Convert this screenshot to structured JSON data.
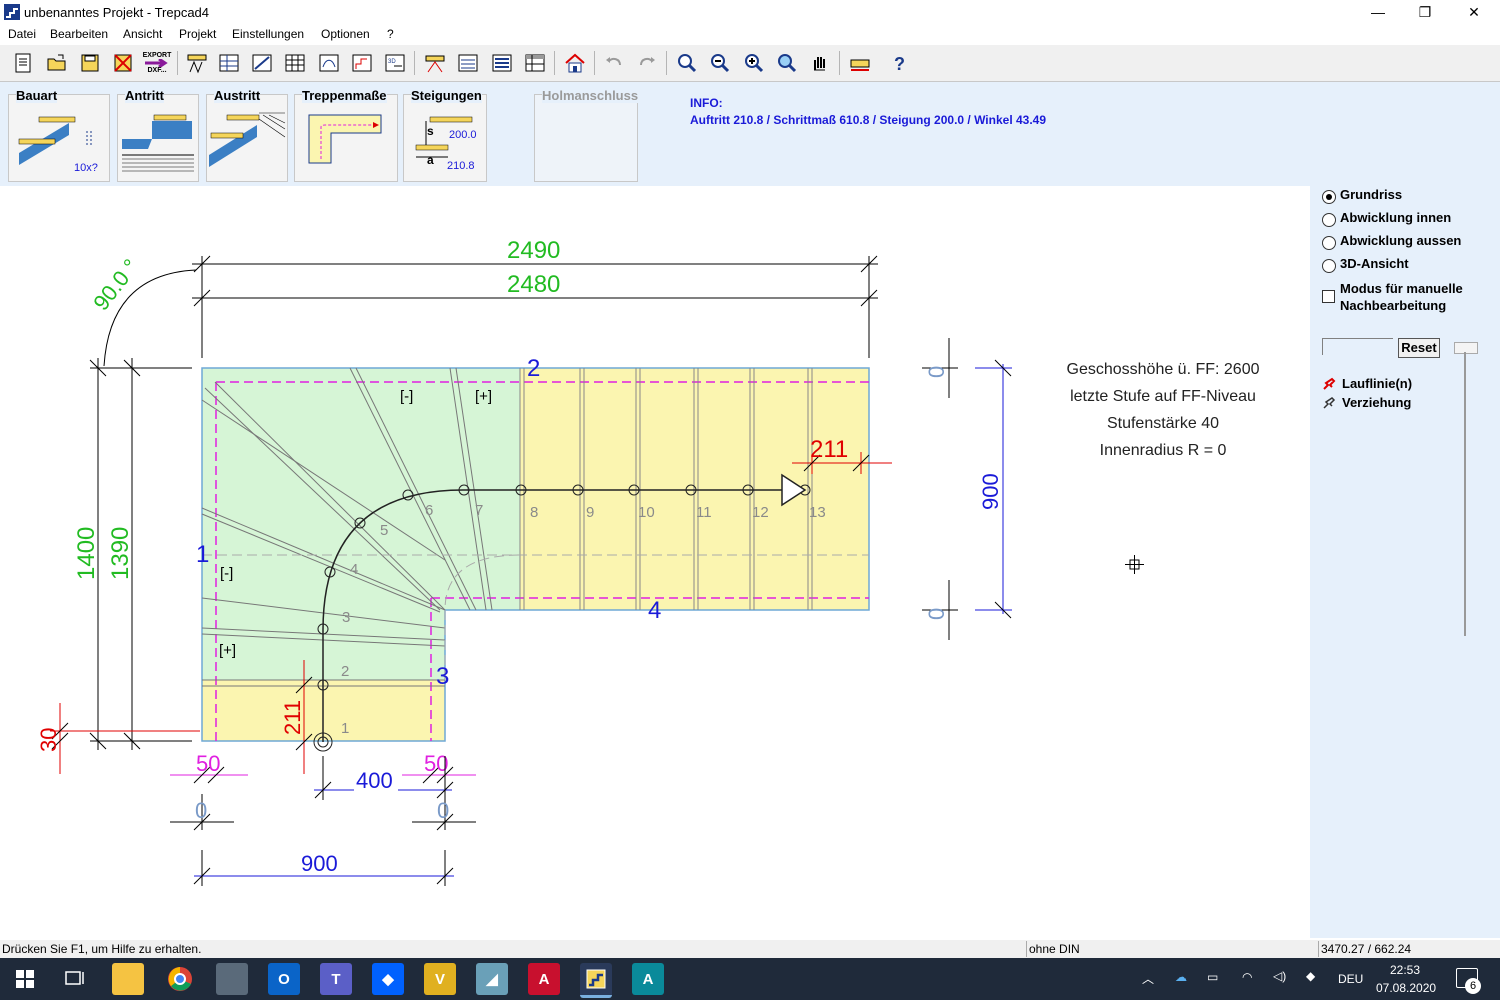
{
  "window": {
    "title": "unbenanntes Projekt - Trepcad4",
    "minimize_glyph": "—",
    "restore_glyph": "❐",
    "close_glyph": "✕"
  },
  "menu": [
    "Datei",
    "Bearbeiten",
    "Ansicht",
    "Projekt",
    "Einstellungen",
    "Optionen",
    "?"
  ],
  "toolbar": {
    "export_label_1": "EXPORT",
    "export_label_2": "DXF...",
    "icons": [
      "new-file-icon",
      "open-folder-icon",
      "save-icon",
      "delete-icon",
      "export-dxf-icon",
      "stair-type-icon",
      "plan-table-icon",
      "stair-side-icon",
      "grid-table-icon",
      "stair-view-icon",
      "profile-icon",
      "3d-view-icon",
      "stair-3d-icon",
      "stair-mirror-icon",
      "list-icon",
      "table-icon",
      "house-icon",
      "undo-icon",
      "redo-icon",
      "zoom-window-icon",
      "zoom-out-icon",
      "zoom-in-icon",
      "zoom-all-icon",
      "pan-icon",
      "measure-icon",
      "help-icon"
    ]
  },
  "panel": {
    "bauart": {
      "label": "Bauart",
      "count": "10x?"
    },
    "antritt": {
      "label": "Antritt"
    },
    "austritt": {
      "label": "Austritt"
    },
    "treppenmasse": {
      "label": "Treppenmaße"
    },
    "steigungen": {
      "label": "Steigungen",
      "s_label": "s",
      "a_label": "a",
      "s_value": "200.0",
      "a_value": "210.8"
    },
    "holmanschluss": {
      "label": "Holmanschluss"
    }
  },
  "info": {
    "heading": "INFO:",
    "text": "Auftritt 210.8 / Schrittmaß 610.8 / Steigung 200.0 / Winkel 43.49"
  },
  "view_options": {
    "grundriss": "Grundriss",
    "innen": "Abwicklung innen",
    "aussen": "Abwicklung aussen",
    "ansicht3d": "3D-Ansicht",
    "manual_line1": "Modus für manuelle",
    "manual_line2": "Nachbearbeitung",
    "selected": "Grundriss",
    "reset": "Reset",
    "lauflinie": "Lauflinie(n)",
    "verziehung": "Verziehung"
  },
  "drawing": {
    "dims": {
      "top_outer": "2490",
      "top_inner": "2480",
      "angle": "90.0 °",
      "left_outer": "1400",
      "left_inner": "1390",
      "right_height": "900",
      "bottom_width": "900",
      "bottom_400": "400",
      "edge_50_left": "50",
      "edge_50_right": "50",
      "red_211_top": "211",
      "red_211_left": "211",
      "red_30": "30",
      "zero": "0"
    },
    "edges": {
      "e1": "1",
      "e2": "2",
      "e3": "3",
      "e4": "4"
    },
    "markers": {
      "minus": "[-]",
      "plus": "[+]"
    },
    "steps": [
      "1",
      "2",
      "3",
      "4",
      "5",
      "6",
      "7",
      "8",
      "9",
      "10",
      "11",
      "12",
      "13"
    ],
    "notes": {
      "n1": "Geschosshöhe ü. FF: 2600",
      "n2": "letzte Stufe auf FF-Niveau",
      "n3": "Stufenstärke 40",
      "n4": "Innenradius R = 0"
    }
  },
  "status": {
    "hint": "Drücken Sie F1, um Hilfe zu erhalten.",
    "din": "ohne DIN",
    "coords": "3470.27 / 662.24"
  },
  "taskbar": {
    "lang": "DEU",
    "time": "22:53",
    "date": "07.08.2020",
    "notifications": "6"
  },
  "colors": {
    "dim_green": "#22bb22",
    "dim_blue": "#1a1ad8",
    "dim_red": "#e00000",
    "dim_magenta": "#e020e0",
    "fill_green": "#d6f5d6",
    "fill_yellow": "#fbf5b0"
  }
}
